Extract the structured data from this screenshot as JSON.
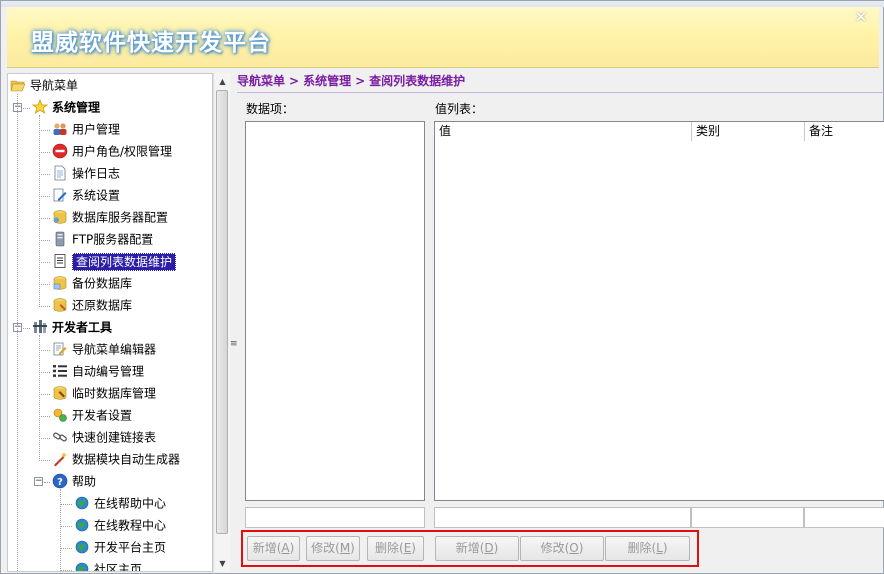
{
  "window": {
    "title": "盟威软件快速开发平台",
    "close_glyph": "✕",
    "colors": {
      "header_bg": "#fff3a8",
      "title_glow": "#4a90d0",
      "selection": "#2a1ea8",
      "breadcrumb": "#7b1fa2",
      "highlight_border": "#e01010"
    }
  },
  "sidebar": {
    "root": {
      "label": "导航菜单",
      "icon": "folder-open-icon"
    },
    "groups": [
      {
        "label": "系统管理",
        "icon": "star-icon",
        "items": [
          {
            "label": "用户管理",
            "icon": "users-icon"
          },
          {
            "label": "用户角色/权限管理",
            "icon": "no-entry-icon"
          },
          {
            "label": "操作日志",
            "icon": "document-icon"
          },
          {
            "label": "系统设置",
            "icon": "settings-doc-icon"
          },
          {
            "label": "数据库服务器配置",
            "icon": "database-server-icon"
          },
          {
            "label": "FTP服务器配置",
            "icon": "ftp-server-icon"
          },
          {
            "label": "查阅列表数据维护",
            "icon": "list-doc-icon",
            "selected": true
          },
          {
            "label": "备份数据库",
            "icon": "database-backup-icon"
          },
          {
            "label": "还原数据库",
            "icon": "database-restore-icon"
          }
        ]
      },
      {
        "label": "开发者工具",
        "icon": "tools-icon",
        "items": [
          {
            "label": "导航菜单编辑器",
            "icon": "edit-doc-icon"
          },
          {
            "label": "自动编号管理",
            "icon": "numbered-list-icon"
          },
          {
            "label": "临时数据库管理",
            "icon": "temp-db-icon"
          },
          {
            "label": "开发者设置",
            "icon": "developer-settings-icon"
          },
          {
            "label": "快速创建链接表",
            "icon": "link-icon"
          },
          {
            "label": "数据模块自动生成器",
            "icon": "wand-icon"
          }
        ]
      },
      {
        "label": "帮助",
        "icon": "help-icon",
        "items": [
          {
            "label": "在线帮助中心",
            "icon": "globe-icon"
          },
          {
            "label": "在线教程中心",
            "icon": "globe-icon"
          },
          {
            "label": "开发平台主页",
            "icon": "globe-icon"
          },
          {
            "label": "社区主页",
            "icon": "globe-icon"
          }
        ]
      }
    ]
  },
  "main": {
    "breadcrumb": [
      "导航菜单",
      "系统管理",
      "查阅列表数据维护"
    ],
    "breadcrumb_sep": ">",
    "data_items_label": "数据项：",
    "values_label": "值列表：",
    "columns": [
      "值",
      "类别",
      "备注"
    ]
  },
  "buttons": [
    {
      "label": "新增(A)",
      "text": "新增(",
      "key": "A",
      "tail": ")"
    },
    {
      "label": "修改(M)",
      "text": "修改(",
      "key": "M",
      "tail": ")"
    },
    {
      "label": "删除(E)",
      "text": "删除(",
      "key": "E",
      "tail": ")"
    },
    {
      "label": "新增(D)",
      "text": "新增(",
      "key": "D",
      "tail": ")"
    },
    {
      "label": "修改(O)",
      "text": "修改(",
      "key": "O",
      "tail": ")"
    },
    {
      "label": "删除(L)",
      "text": "删除(",
      "key": "L",
      "tail": ")"
    }
  ]
}
